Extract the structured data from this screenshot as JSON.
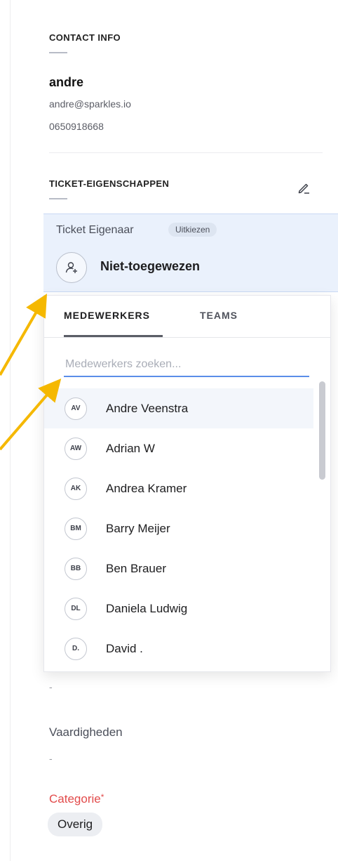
{
  "contact_info": {
    "title": "CONTACT INFO",
    "name": "andre",
    "email": "andre@sparkles.io",
    "phone": "0650918668"
  },
  "ticket_properties": {
    "title": "TICKET-EIGENSCHAPPEN",
    "edit_icon": "pencil-icon"
  },
  "owner": {
    "label": "Ticket Eigenaar",
    "badge": "Uitkiezen",
    "value": "Niet-toegewezen",
    "icon": "user-add-icon"
  },
  "dropdown": {
    "tabs": [
      {
        "label": "MEDEWERKERS",
        "active": true
      },
      {
        "label": "TEAMS",
        "active": false
      }
    ],
    "search_placeholder": "Medewerkers zoeken...",
    "agents": [
      {
        "initials": "AV",
        "name": "Andre Veenstra",
        "highlighted": true
      },
      {
        "initials": "AW",
        "name": "Adrian W"
      },
      {
        "initials": "AK",
        "name": "Andrea Kramer"
      },
      {
        "initials": "BM",
        "name": "Barry Meijer"
      },
      {
        "initials": "BB",
        "name": "Ben Brauer"
      },
      {
        "initials": "DL",
        "name": "Daniela Ludwig"
      },
      {
        "initials": "D.",
        "name": "David ."
      }
    ]
  },
  "fields": {
    "empty_dash": "-",
    "skills_label": "Vaardigheden",
    "skills_value": "-",
    "category_label": "Categorie",
    "category_required_mark": "*",
    "category_value": "Overig"
  },
  "colors": {
    "accent_blue": "#5b8ee8",
    "owner_highlight": "#eaf1fc",
    "required_red": "#e24b4b",
    "annotation_arrow": "#f5b800"
  }
}
